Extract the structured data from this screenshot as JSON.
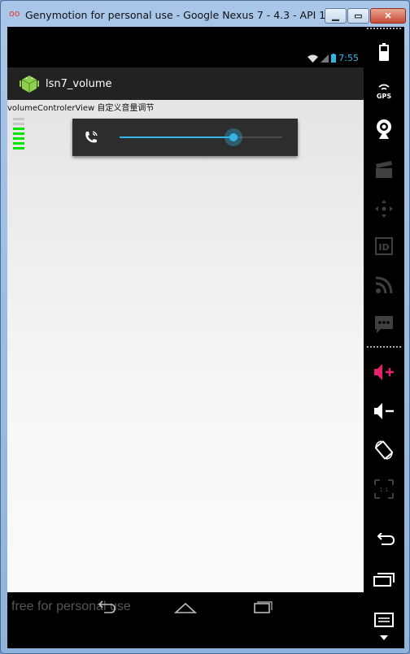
{
  "window": {
    "title": "Genymotion for personal use - Google Nexus 7 - 4.3 - API 1...",
    "buttons": [
      "minimize",
      "maximize",
      "close"
    ]
  },
  "status_bar": {
    "time": "7:55"
  },
  "action_bar": {
    "title": "lsn7_volume",
    "icon": "android-icon"
  },
  "content": {
    "label": "volumeControlerView 自定义音量调节",
    "volume_levels": {
      "total": 7,
      "active": 5,
      "active_color": "#00e600",
      "inactive_color": "#c8c8c8"
    }
  },
  "volume_popup": {
    "icon": "phone-call-volume-icon",
    "level": 0.7,
    "accent": "#33b5e5"
  },
  "nav_bar": {
    "watermark": "free for personal use",
    "buttons": [
      "back",
      "home",
      "recent-apps"
    ]
  },
  "side_panel": {
    "items": [
      "battery-icon",
      "gps-icon",
      "webcam-icon",
      "clapperboard-icon",
      "dpad-icon",
      "id-icon",
      "rss-icon",
      "sms-icon",
      "volume-up-icon",
      "volume-down-icon",
      "rotate-icon",
      "fullscreen-icon",
      "back-icon",
      "recent-apps-icon",
      "menu-icon"
    ]
  }
}
